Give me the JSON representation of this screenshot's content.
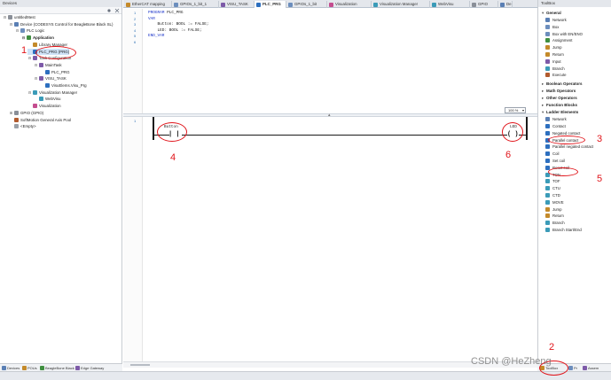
{
  "devices": {
    "title": "Devices",
    "tree": [
      {
        "label": "untitled9test",
        "icon": "project-icon",
        "color": "#8a8f98",
        "indent": 0,
        "toggle": "−",
        "bold": false
      },
      {
        "label": "Device (CODESYS Control for BeagleBone Black SL)",
        "icon": "device-icon",
        "color": "#5a7fb4",
        "indent": 1,
        "toggle": "−",
        "bold": false
      },
      {
        "label": "PLC Logic",
        "icon": "plc-logic-icon",
        "color": "#6c8ebd",
        "indent": 2,
        "toggle": "−",
        "bold": false
      },
      {
        "label": "Application",
        "icon": "application-icon",
        "color": "#3f8f3f",
        "indent": 3,
        "toggle": "−",
        "bold": true
      },
      {
        "label": "Library Manager",
        "icon": "library-manager-icon",
        "color": "#c48a2a",
        "indent": 4,
        "toggle": "",
        "bold": false
      },
      {
        "label": "PLC_PRG (PRG)",
        "icon": "program-icon",
        "color": "#2d6fbf",
        "indent": 4,
        "toggle": "",
        "bold": false,
        "selected": true
      },
      {
        "label": "Task Configuration",
        "icon": "task-config-icon",
        "color": "#7d5aa8",
        "indent": 4,
        "toggle": "−",
        "bold": false
      },
      {
        "label": "MainTask",
        "icon": "task-icon",
        "color": "#7d5aa8",
        "indent": 5,
        "toggle": "−",
        "bold": false
      },
      {
        "label": "PLC_PRG",
        "icon": "program-call-icon",
        "color": "#2d6fbf",
        "indent": 6,
        "toggle": "",
        "bold": false
      },
      {
        "label": "VISU_TASK",
        "icon": "task-icon",
        "color": "#7d5aa8",
        "indent": 5,
        "toggle": "−",
        "bold": false
      },
      {
        "label": "VisuElems.Visu_Prg",
        "icon": "program-call-icon",
        "color": "#2d6fbf",
        "indent": 6,
        "toggle": "",
        "bold": false
      },
      {
        "label": "Visualization Manager",
        "icon": "visu-manager-icon",
        "color": "#3b9bb8",
        "indent": 4,
        "toggle": "−",
        "bold": false
      },
      {
        "label": "WebVisu",
        "icon": "webvisu-icon",
        "color": "#3b9bb8",
        "indent": 5,
        "toggle": "",
        "bold": false
      },
      {
        "label": "Visualization",
        "icon": "visualization-icon",
        "color": "#c44d8f",
        "indent": 4,
        "toggle": "",
        "bold": false
      },
      {
        "label": "GPIO (GPIO)",
        "icon": "gpio-icon",
        "color": "#8a8f98",
        "indent": 1,
        "toggle": "+",
        "bold": false
      },
      {
        "label": "SoftMotion General Axis Pool",
        "icon": "softmotion-icon",
        "color": "#b25b2e",
        "indent": 1,
        "toggle": "",
        "bold": false
      },
      {
        "label": "<Empty>",
        "icon": "empty-slot-icon",
        "color": "#9aa0a8",
        "indent": 1,
        "toggle": "",
        "bold": false
      }
    ],
    "bottom_tabs": [
      "Devices",
      "POUs",
      "BeagleBone Black",
      "Edge Gateway"
    ]
  },
  "editor_tabs": [
    {
      "label": "EtherCAT mapping",
      "active": false
    },
    {
      "label": "GPIOs_1_bit_1",
      "active": false
    },
    {
      "label": "VISU_TASK",
      "active": false
    },
    {
      "label": "PLC_PRG",
      "active": true
    },
    {
      "label": "GPIOs_1_bit",
      "active": false
    },
    {
      "label": "Visualization",
      "active": false
    },
    {
      "label": "Visualization Manager",
      "active": false
    },
    {
      "label": "WebVisu",
      "active": false
    },
    {
      "label": "GPIO",
      "active": false
    },
    {
      "label": "De",
      "active": false
    }
  ],
  "declaration": {
    "line_numbers": [
      "1",
      "2",
      "3",
      "4",
      "5",
      "6"
    ],
    "lines": [
      {
        "kw": "PROGRAM",
        "rest": " PLC_PRG"
      },
      {
        "kw": "VAR",
        "rest": ""
      },
      {
        "kw": "",
        "rest": "    Button: BOOL := FALSE;"
      },
      {
        "kw": "",
        "rest": "    LED: BOOL := FALSE;"
      },
      {
        "kw": "END_VAR",
        "rest": ""
      },
      {
        "kw": "",
        "rest": ""
      }
    ],
    "zoom": "100 %"
  },
  "ladder": {
    "rung_number": "1",
    "contact_var": "Button",
    "contact_symbol": "| |",
    "coil_var": "LED",
    "coil_symbol": "( )"
  },
  "toolbox": {
    "title": "ToolBox",
    "groups": [
      {
        "label": "General",
        "expanded": true,
        "items": [
          "Network",
          "Box",
          "Box with EN/ENO",
          "Assignment",
          "Jump",
          "Return",
          "Input",
          "Branch",
          "Execute"
        ]
      },
      {
        "label": "Boolean Operators",
        "expanded": false,
        "items": []
      },
      {
        "label": "Math Operators",
        "expanded": false,
        "items": []
      },
      {
        "label": "Other Operators",
        "expanded": false,
        "items": []
      },
      {
        "label": "Function Blocks",
        "expanded": false,
        "items": []
      },
      {
        "label": "Ladder Elements",
        "expanded": true,
        "items": [
          "Network",
          "Contact",
          "Negated contact",
          "Parallel contact",
          "Parallel negated contact",
          "Coil",
          "Set coil",
          "Reset coil",
          "TON",
          "TOF",
          "CTU",
          "CTD",
          "MOVE",
          "Jump",
          "Return",
          "Branch",
          "Branch Start/End"
        ]
      }
    ],
    "bottom_tabs": [
      "ToolBox",
      "Pr",
      "Assem"
    ]
  },
  "annotations": [
    "1",
    "2",
    "3",
    "4",
    "5",
    "6"
  ],
  "watermark": "CSDN @HeZheng"
}
